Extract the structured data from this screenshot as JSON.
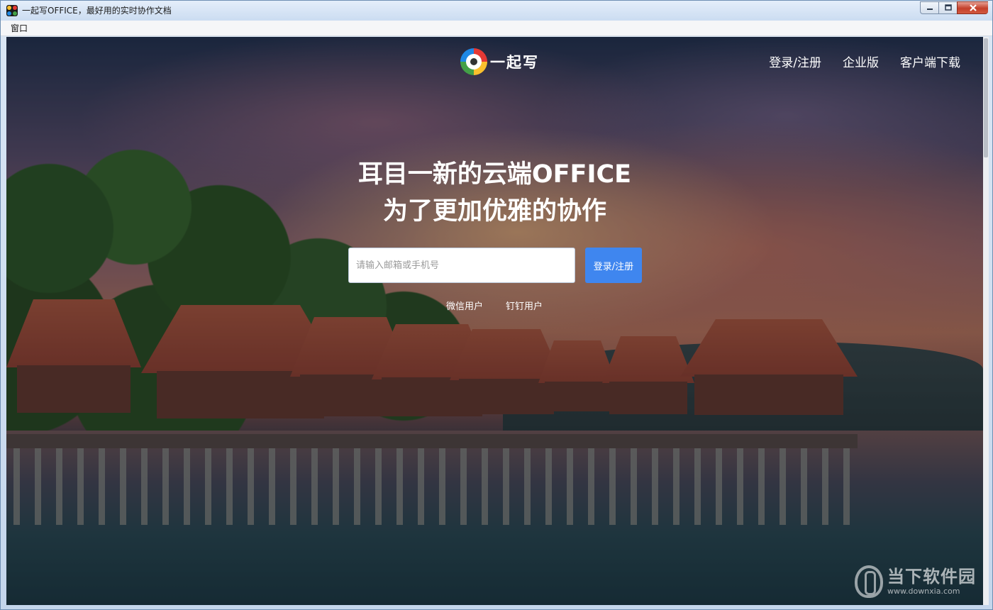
{
  "window": {
    "title": "一起写OFFICE，最好用的实时协作文档",
    "menu": [
      "窗口"
    ]
  },
  "header": {
    "logo_text": "一起写",
    "nav": [
      {
        "label": "登录/注册"
      },
      {
        "label": "企业版"
      },
      {
        "label": "客户端下载"
      }
    ]
  },
  "hero": {
    "line1": "耳目一新的云端OFFICE",
    "line2": "为了更加优雅的协作"
  },
  "login": {
    "placeholder": "请输入邮箱或手机号",
    "button_label": "登录/注册",
    "alt_wechat": "微信用户",
    "alt_dingtalk": "钉钉用户"
  },
  "watermark": {
    "name": "当下软件园",
    "url": "www.downxia.com"
  },
  "colors": {
    "accent_button": "#3f86ef",
    "close_button": "#c4402b"
  },
  "icons": {
    "app": "app-icon",
    "minimize": "minimize-icon",
    "maximize": "maximize-icon",
    "close": "close-icon",
    "logo": "logo-mark-icon"
  }
}
